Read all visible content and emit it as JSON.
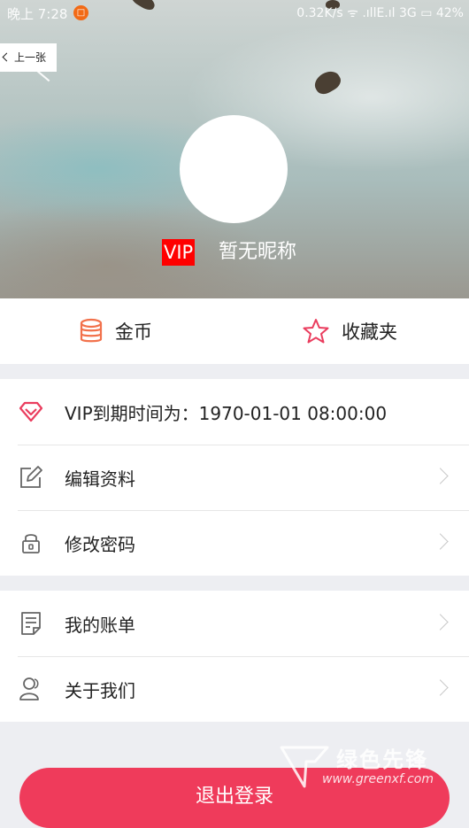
{
  "status_bar": {
    "time": "晚上 7:28",
    "right": "0.32K/s  ᯤ .ıllE.ıl 3G ▭ 42%"
  },
  "nav": {
    "prev_label": "上一张"
  },
  "profile": {
    "vip_badge": "VIP",
    "nickname": "暂无昵称"
  },
  "wallet": {
    "coins_label": "金币",
    "favorites_label": "收藏夹"
  },
  "account_section": {
    "vip_expiry": "VIP到期时间为：1970-01-01 08:00:00",
    "edit_profile": "编辑资料",
    "change_password": "修改密码"
  },
  "misc_section": {
    "my_bills": "我的账单",
    "about_us": "关于我们"
  },
  "logout_label": "退出登录",
  "watermark": {
    "title": "绿色先锋",
    "url": "www.greenxf.com"
  },
  "colors": {
    "accent": "#ef3b5b",
    "vip_red": "#ff0000",
    "coin_orange": "#f2714b",
    "star_red": "#ea3d5e"
  }
}
